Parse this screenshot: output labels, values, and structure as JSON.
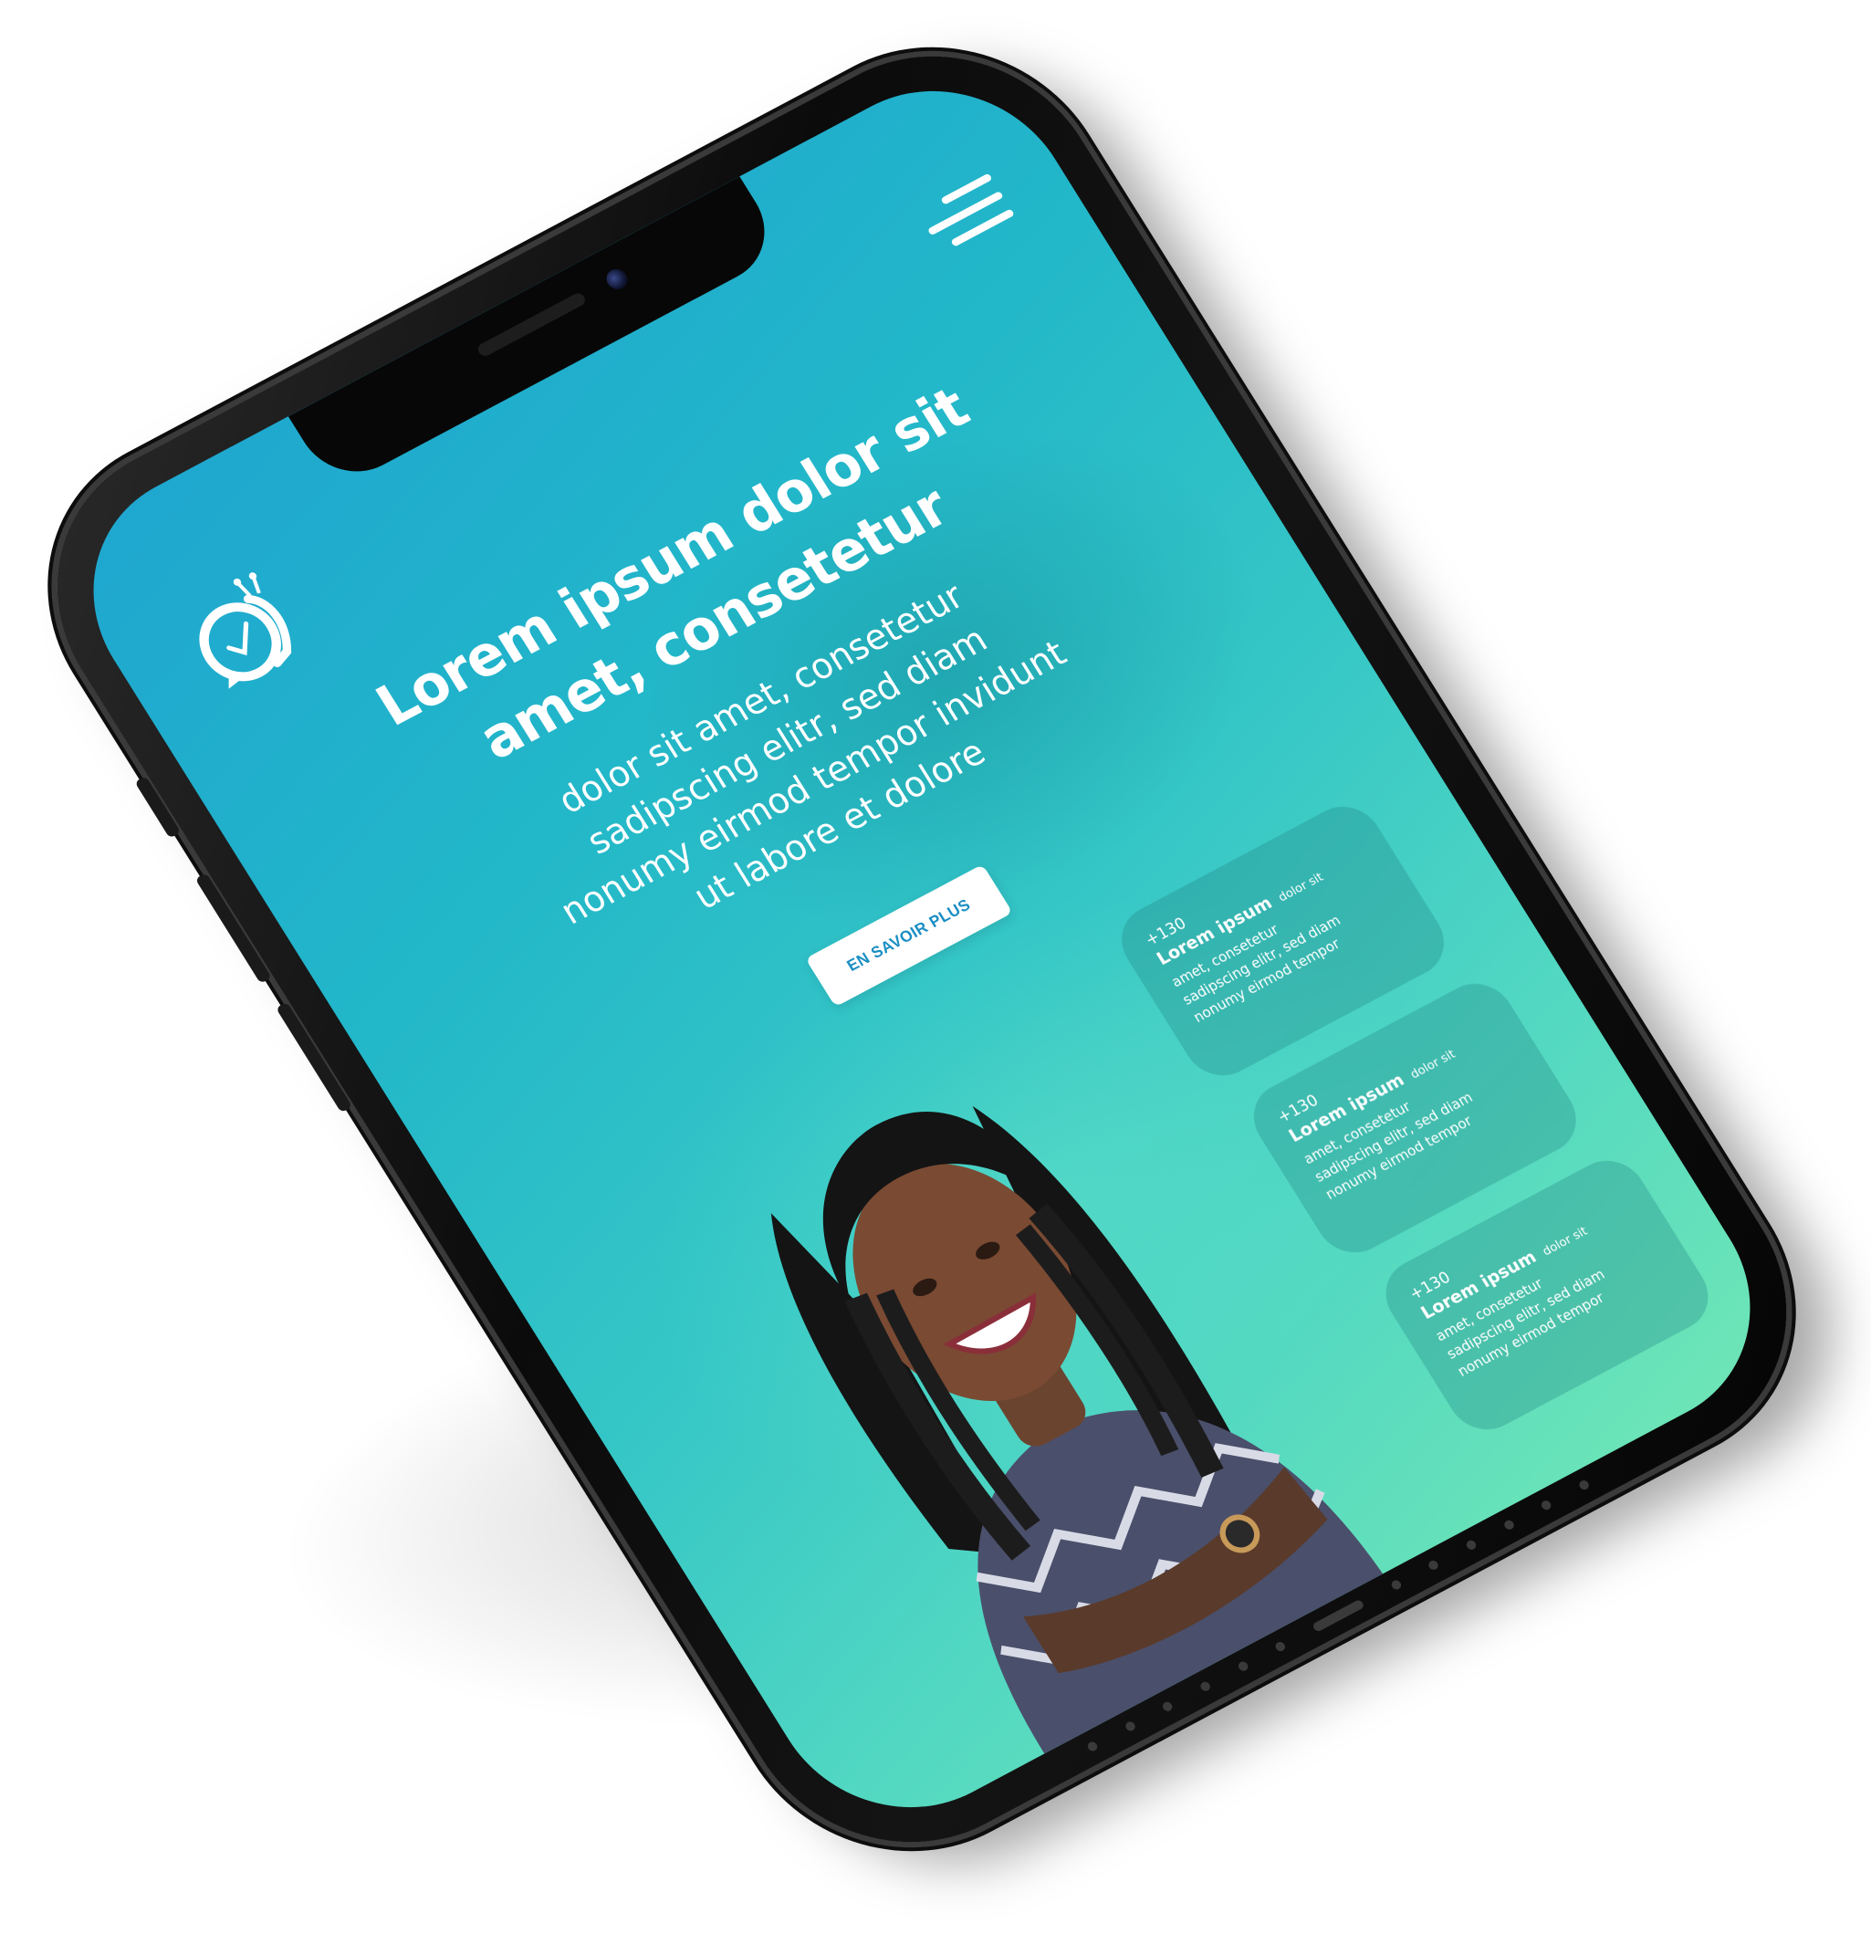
{
  "header": {
    "logo_icon": "snail-clock-logo-icon",
    "menu_icon": "hamburger-menu-icon"
  },
  "hero": {
    "headline_line1": "Lorem ipsum dolor sit",
    "headline_line2": "amet, consetetur",
    "paragraph_lines": [
      "dolor sit amet, consetetur",
      "sadipscing elitr, sed diam",
      "nonumy eirmod tempor invidunt",
      "ut labore et dolore"
    ],
    "cta_label": "EN SAVOIR PLUS"
  },
  "stats": [
    {
      "count": "+130",
      "title": "Lorem ipsum",
      "title_suffix": "dolor sit",
      "lines": [
        "amet, consetetur",
        "sadipscing elitr, sed diam",
        "nonumy eirmod tempor"
      ]
    },
    {
      "count": "+130",
      "title": "Lorem ipsum",
      "title_suffix": "dolor sit",
      "lines": [
        "amet, consetetur",
        "sadipscing elitr, sed diam",
        "nonumy eirmod tempor"
      ]
    },
    {
      "count": "+130",
      "title": "Lorem ipsum",
      "title_suffix": "dolor sit",
      "lines": [
        "amet, consetetur",
        "sadipscing elitr, sed diam",
        "nonumy eirmod tempor"
      ]
    }
  ],
  "colors": {
    "gradient_top": "#1fa6d0",
    "gradient_bottom": "#6fe6b6",
    "cta_text": "#1a8ec3",
    "phone_body": "#0b0b0b"
  }
}
